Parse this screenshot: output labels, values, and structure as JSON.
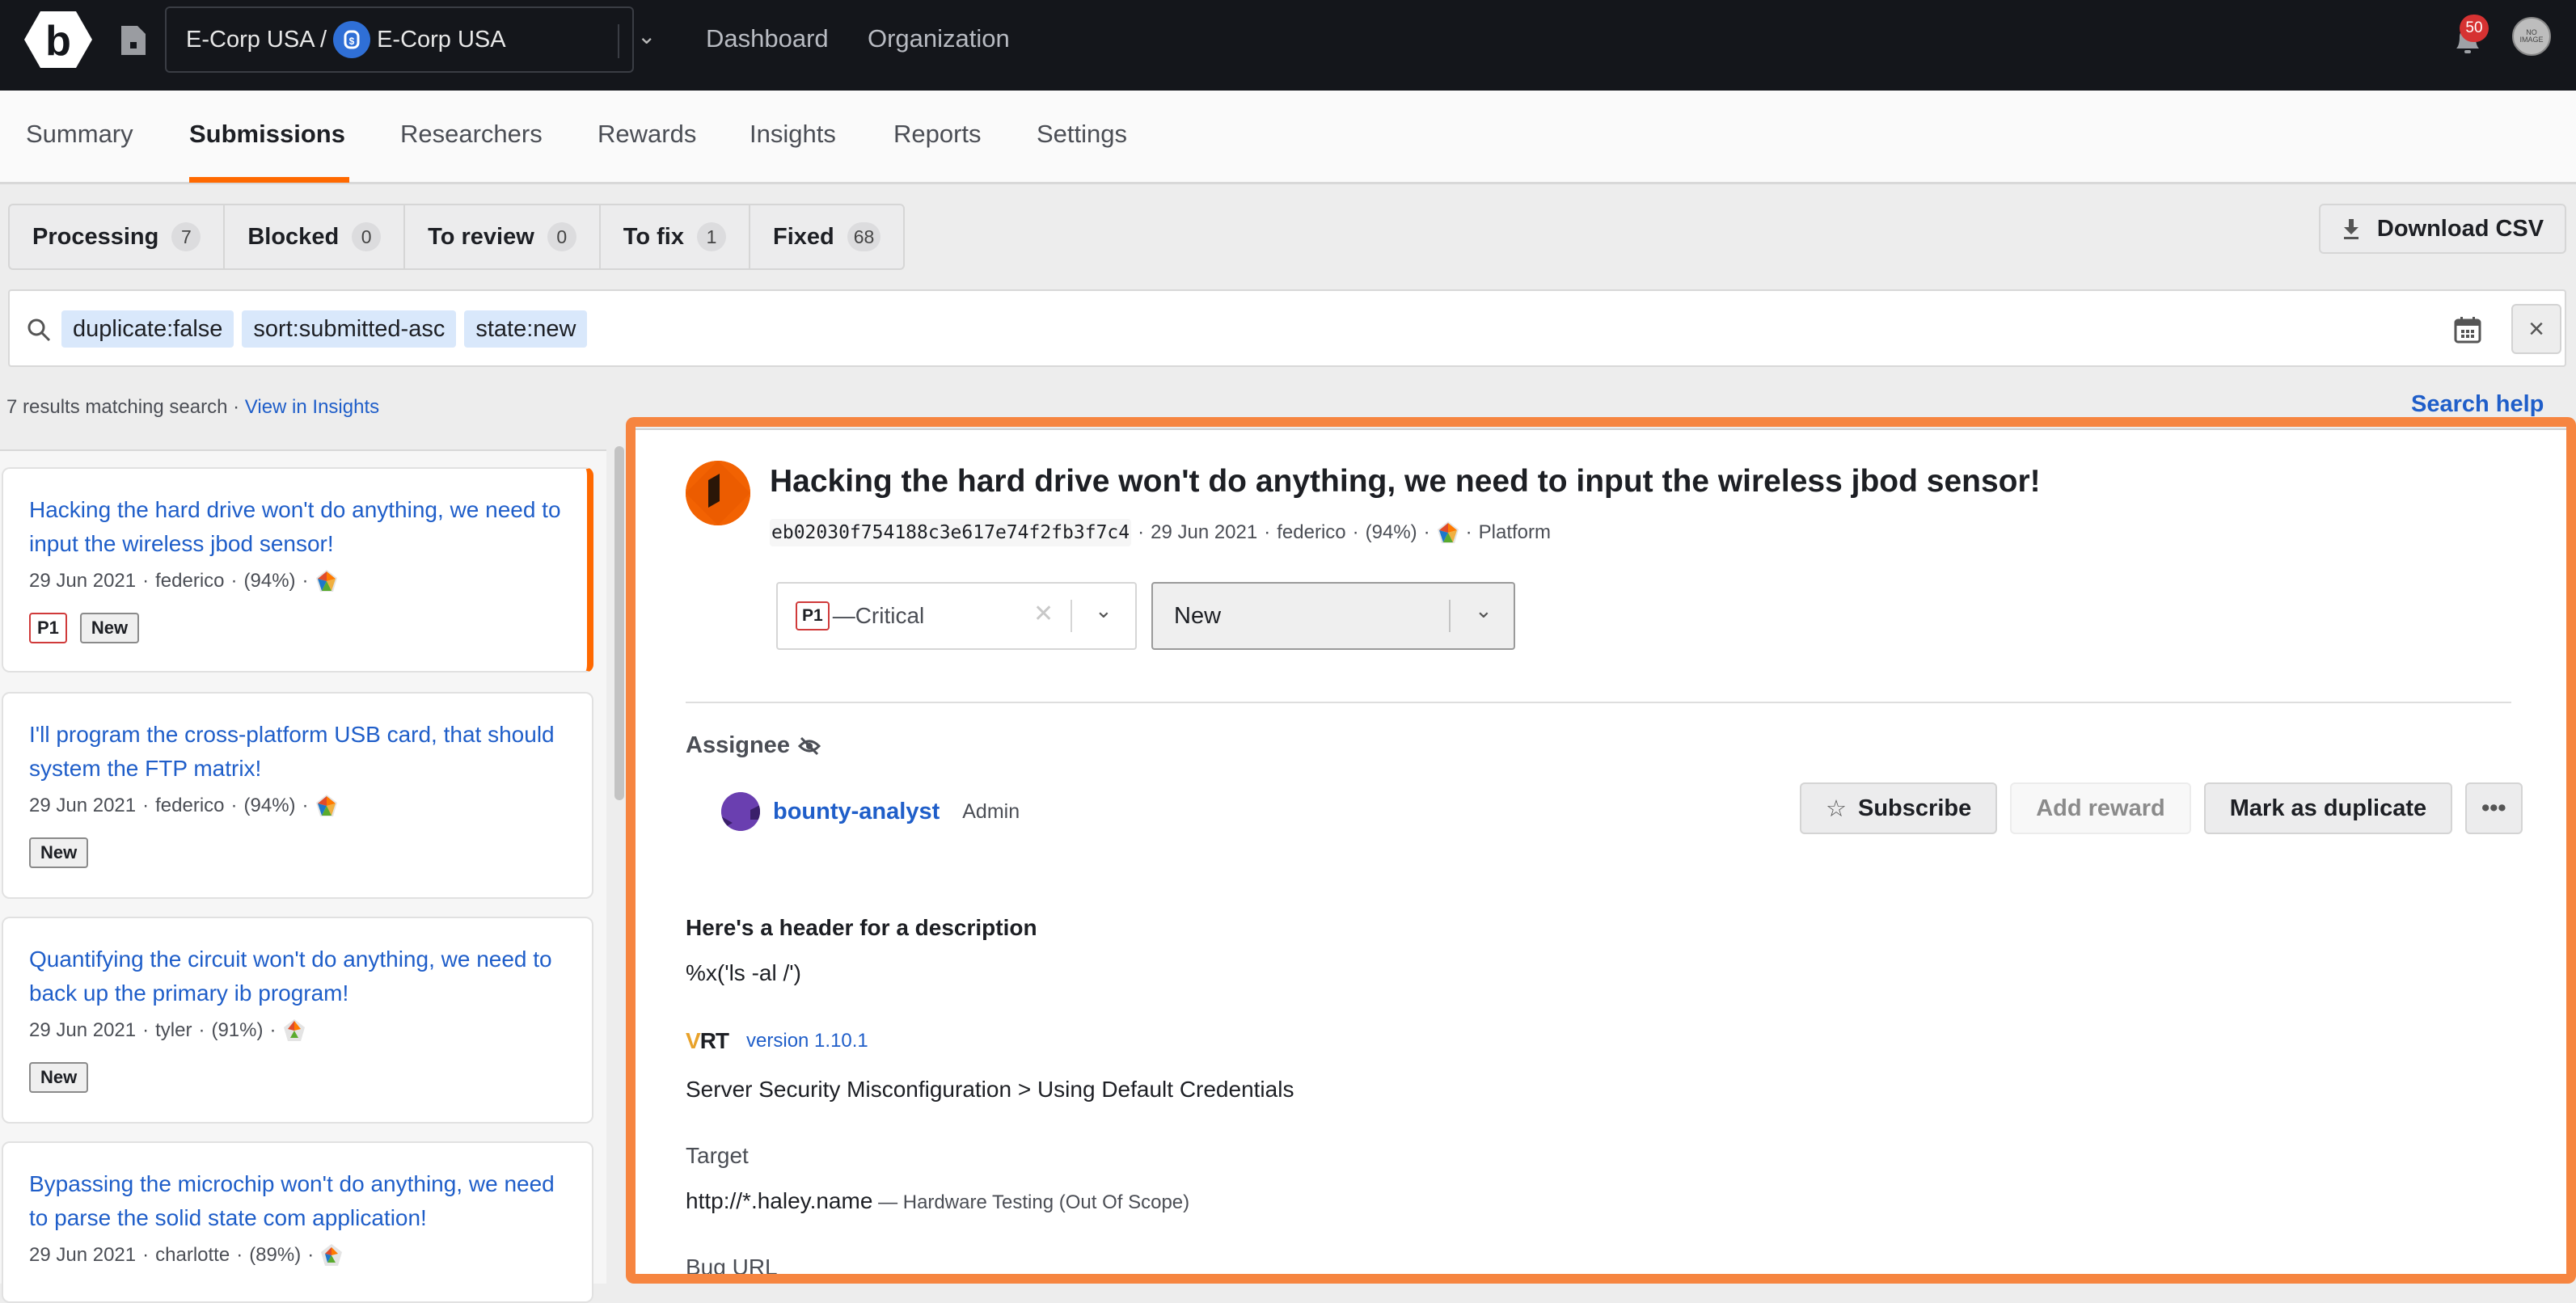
{
  "topbar": {
    "org_path": "E-Corp USA /",
    "org_name": "E-Corp USA",
    "nav": [
      "Dashboard",
      "Organization"
    ],
    "notification_count": "50",
    "avatar_text": "NO IMAGE"
  },
  "tabs": [
    {
      "label": "Summary",
      "active": false
    },
    {
      "label": "Submissions",
      "active": true
    },
    {
      "label": "Researchers",
      "active": false
    },
    {
      "label": "Rewards",
      "active": false
    },
    {
      "label": "Insights",
      "active": false
    },
    {
      "label": "Reports",
      "active": false
    },
    {
      "label": "Settings",
      "active": false
    }
  ],
  "filters": [
    {
      "label": "Processing",
      "count": "7"
    },
    {
      "label": "Blocked",
      "count": "0"
    },
    {
      "label": "To review",
      "count": "0"
    },
    {
      "label": "To fix",
      "count": "1"
    },
    {
      "label": "Fixed",
      "count": "68"
    }
  ],
  "download_csv": "Download CSV",
  "search": {
    "chips": [
      "duplicate:false",
      "sort:submitted-asc",
      "state:new"
    ]
  },
  "results": {
    "summary": "7 results matching search",
    "separator": " · ",
    "insights_link": "View in Insights",
    "help_link": "Search help"
  },
  "submissions": [
    {
      "title": "Hacking the hard drive won't do anything, we need to input the wireless jbod sensor!",
      "date": "29 Jun 2021",
      "researcher": "federico",
      "score": "(94%)",
      "priority": "P1",
      "state": "New",
      "selected": true
    },
    {
      "title": "I'll program the cross-platform USB card, that should system the FTP matrix!",
      "date": "29 Jun 2021",
      "researcher": "federico",
      "score": "(94%)",
      "priority": "",
      "state": "New",
      "selected": false
    },
    {
      "title": "Quantifying the circuit won't do anything, we need to back up the primary ib program!",
      "date": "29 Jun 2021",
      "researcher": "tyler",
      "score": "(91%)",
      "priority": "",
      "state": "New",
      "selected": false
    },
    {
      "title": "Bypassing the microchip won't do anything, we need to parse the solid state com application!",
      "date": "29 Jun 2021",
      "researcher": "charlotte",
      "score": "(89%)",
      "priority": "",
      "state": "",
      "selected": false
    }
  ],
  "detail": {
    "title": "Hacking the hard drive won't do anything, we need to input the wireless jbod sensor!",
    "hash": "eb02030f754188c3e617e74f2fb3f7c4",
    "date": "29 Jun 2021",
    "researcher": "federico",
    "score": "(94%)",
    "platform": "Platform",
    "severity_priority": "P1",
    "severity_label": "—Critical",
    "state": "New",
    "assignee_label": "Assignee",
    "assignee_name": "bounty-analyst",
    "assignee_role": "Admin",
    "actions": {
      "subscribe": "Subscribe",
      "add_reward": "Add reward",
      "mark_duplicate": "Mark as duplicate",
      "more": "•••"
    },
    "description_header": "Here's a header for a description",
    "description_body": "%x('ls -al /')",
    "vrt_logo": "VRT",
    "vrt_version": "version 1.10.1",
    "vrt_category": "Server Security Misconfiguration > Using Default Credentials",
    "target_label": "Target",
    "target_value": "http://*.haley.name",
    "target_dash": " — ",
    "target_note": "Hardware Testing (Out Of Scope)",
    "bug_url_label": "Bug URL"
  },
  "colors": {
    "accent": "#ff6900",
    "link": "#1f5ec9",
    "highlight": "#f68540",
    "danger": "#d03a3a"
  }
}
